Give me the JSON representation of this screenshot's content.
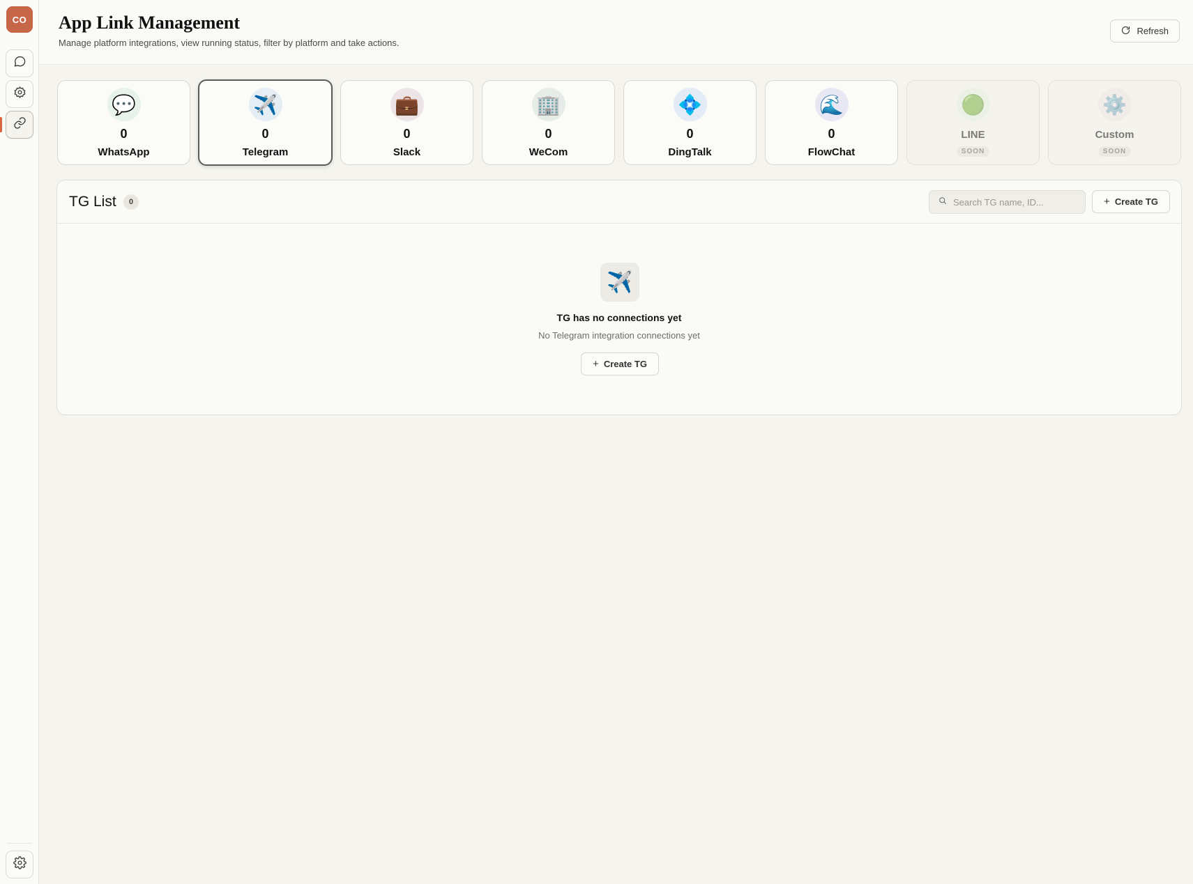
{
  "sidebar": {
    "avatar_initials": "CO",
    "nav": [
      {
        "icon": "chat-bubble-icon"
      },
      {
        "icon": "settings-cog-icon"
      },
      {
        "icon": "link-icon",
        "active": true
      }
    ],
    "bottom": {
      "icon": "gear-icon"
    },
    "active_color": "#d9663f",
    "avatar_color": "#c8664a"
  },
  "header": {
    "title": "App Link Management",
    "subtitle": "Manage platform integrations, view running status, filter by platform and take actions.",
    "refresh_label": "Refresh"
  },
  "platforms": [
    {
      "name": "WhatsApp",
      "count": "0",
      "icon": "💬",
      "icon_bg": "#e7f3ea"
    },
    {
      "name": "Telegram",
      "count": "0",
      "icon": "✈️",
      "icon_bg": "#e4eef4",
      "selected": true
    },
    {
      "name": "Slack",
      "count": "0",
      "icon": "💼",
      "icon_bg": "#ece4e6"
    },
    {
      "name": "WeCom",
      "count": "0",
      "icon": "🏢",
      "icon_bg": "#e6ece8"
    },
    {
      "name": "DingTalk",
      "count": "0",
      "icon": "💠",
      "icon_bg": "#e3ebf6"
    },
    {
      "name": "FlowChat",
      "count": "0",
      "icon": "🌊",
      "icon_bg": "#e8e8f4"
    },
    {
      "name": "LINE",
      "badge": "SOON",
      "icon": "🟢",
      "icon_bg": "#e6f0e2",
      "disabled": true
    },
    {
      "name": "Custom",
      "badge": "SOON",
      "icon": "⚙️",
      "icon_bg": "#f0e8e4",
      "disabled": true
    }
  ],
  "list": {
    "title": "TG List",
    "count": "0",
    "search_placeholder": "Search TG name, ID...",
    "create_label": "Create TG",
    "empty_icon": "✈️",
    "empty_title": "TG has no connections yet",
    "empty_subtitle": "No Telegram integration connections yet",
    "empty_create_label": "Create TG"
  }
}
